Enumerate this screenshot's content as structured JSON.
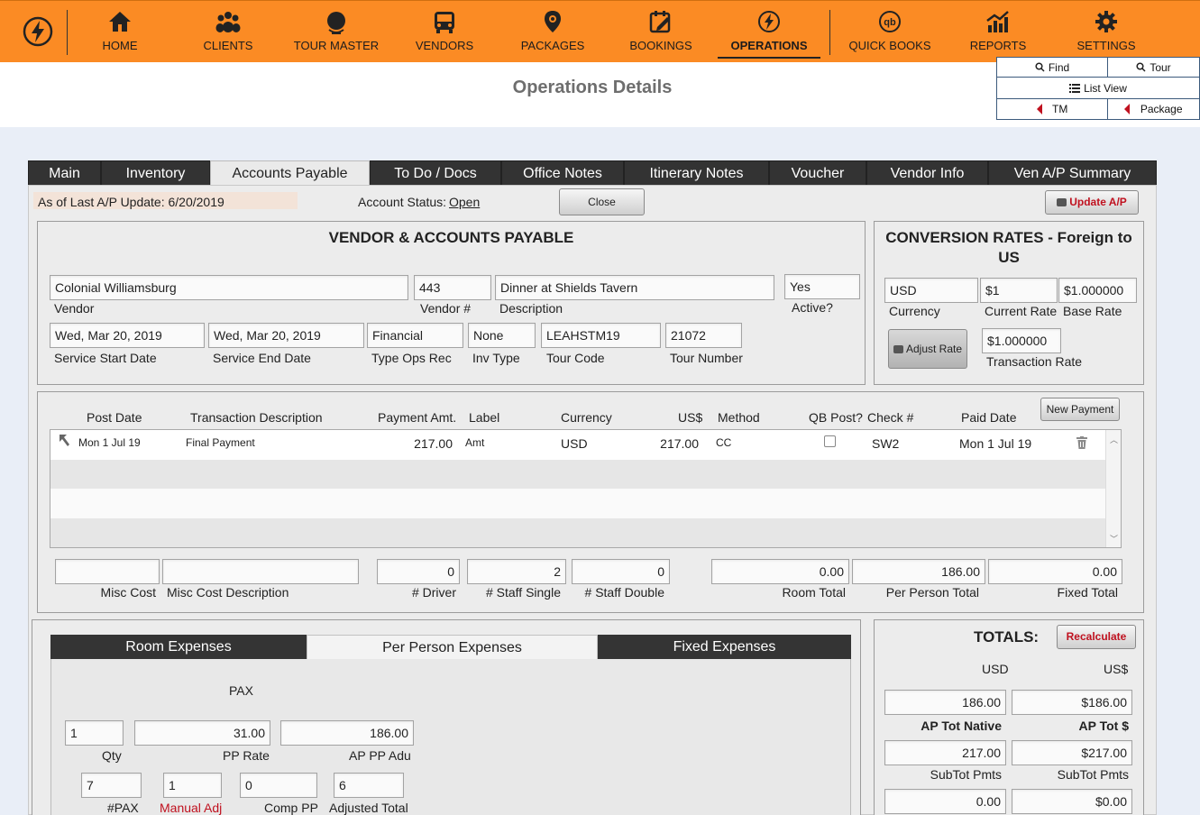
{
  "nav": [
    {
      "label": "HOME",
      "icon": "home-icon"
    },
    {
      "label": "CLIENTS",
      "icon": "clients-icon"
    },
    {
      "label": "TOUR MASTER",
      "icon": "globe-icon"
    },
    {
      "label": "VENDORS",
      "icon": "bus-icon"
    },
    {
      "label": "PACKAGES",
      "icon": "map-pin-icon"
    },
    {
      "label": "BOOKINGS",
      "icon": "calendar-edit-icon"
    },
    {
      "label": "OPERATIONS",
      "icon": "bolt-icon"
    },
    {
      "label": "QUICK BOOKS",
      "icon": "quickbooks-icon"
    },
    {
      "label": "REPORTS",
      "icon": "chart-icon"
    },
    {
      "label": "SETTINGS",
      "icon": "gear-icon"
    }
  ],
  "page_title": "Operations Details",
  "quick_buttons": {
    "find": "Find",
    "tour": "Tour",
    "list_view": "List View",
    "tm": "TM",
    "package": "Package"
  },
  "tabs": [
    "Main",
    "Inventory",
    "Accounts Payable",
    "To Do / Docs",
    "Office Notes",
    "Itinerary Notes",
    "Voucher",
    "Vendor Info",
    "Ven A/P Summary"
  ],
  "status": {
    "last_update": "As of Last A/P Update: 6/20/2019",
    "account_status_label": "Account Status:",
    "account_status_value": "Open",
    "close": "Close",
    "update_ap": "Update A/P"
  },
  "vendor_section": {
    "title": "VENDOR & ACCOUNTS PAYABLE",
    "vendor": "Colonial Williamsburg",
    "vendor_label": "Vendor",
    "vendor_num": "443",
    "vendor_num_label": "Vendor #",
    "description": "Dinner at Shields Tavern",
    "description_label": "Description",
    "active": "Yes",
    "active_label": "Active?",
    "start_date": "Wed, Mar 20, 2019",
    "start_label": "Service Start Date",
    "end_date": "Wed, Mar 20, 2019",
    "end_label": "Service End Date",
    "type_ops": "Financial",
    "type_ops_label": "Type Ops Rec",
    "inv_type": "None",
    "inv_type_label": "Inv Type",
    "tour_code": "LEAHSTM19",
    "tour_code_label": "Tour Code",
    "tour_number": "21072",
    "tour_number_label": "Tour Number"
  },
  "conversion": {
    "title": "CONVERSION RATES - Foreign to US",
    "currency": "USD",
    "currency_label": "Currency",
    "current_rate": "$1",
    "current_rate_label": "Current Rate",
    "base_rate": "$1.000000",
    "base_rate_label": "Base Rate",
    "adjust": "Adjust Rate",
    "transaction_rate": "$1.000000",
    "transaction_rate_label": "Transaction Rate"
  },
  "payments": {
    "headers": {
      "post_date": "Post Date",
      "desc": "Transaction Description",
      "amt": "Payment Amt.",
      "label": "Label",
      "currency": "Currency",
      "us": "US$",
      "method": "Method",
      "qb": "QB Post?",
      "check": "Check #",
      "paid": "Paid Date"
    },
    "new_payment": "New Payment",
    "rows": [
      {
        "post_date": "Mon 1 Jul 19",
        "desc": "Final Payment",
        "amt": "217.00",
        "label": "Amt",
        "currency": "USD",
        "us": "217.00",
        "method": "CC",
        "check": "SW2",
        "paid": "Mon 1 Jul 19"
      }
    ]
  },
  "misc": {
    "misc_cost": "",
    "misc_cost_label": "Misc Cost",
    "misc_desc": "",
    "misc_desc_label": "Misc Cost Description",
    "driver": "0",
    "driver_label": "# Driver",
    "staff_single": "2",
    "staff_single_label": "# Staff Single",
    "staff_double": "0",
    "staff_double_label": "# Staff Double",
    "room_total": "0.00",
    "room_total_label": "Room Total",
    "pp_total": "186.00",
    "pp_total_label": "Per Person Total",
    "fixed_total": "0.00",
    "fixed_total_label": "Fixed Total"
  },
  "expense_tabs": [
    "Room Expenses",
    "Per Person Expenses",
    "Fixed Expenses"
  ],
  "per_person": {
    "pax_title": "PAX",
    "qty": "1",
    "qty_label": "Qty",
    "pp_rate": "31.00",
    "pp_rate_label": "PP Rate",
    "ap_pp": "186.00",
    "ap_pp_label": "AP PP Adu",
    "pax": "7",
    "pax_label": "#PAX",
    "manual": "1",
    "manual_label": "Manual Adj",
    "comp": "0",
    "comp_label": "Comp PP",
    "adjusted": "6",
    "adjusted_label": "Adjusted Total"
  },
  "totals": {
    "title": "TOTALS:",
    "recalc": "Recalculate",
    "col1": "USD",
    "col2": "US$",
    "ap_native": "186.00",
    "ap_us": "$186.00",
    "ap_native_label": "AP Tot Native",
    "ap_us_label": "AP Tot $",
    "sub_native": "217.00",
    "sub_us": "$217.00",
    "sub_label1": "SubTot Pmts",
    "sub_label2": "SubTot Pmts",
    "bal_native": "0.00",
    "bal_us": "$0.00"
  },
  "colors": {
    "nav_bg": "#fb8b24",
    "accent_red": "#c0111f",
    "dark_tab": "#333333"
  }
}
